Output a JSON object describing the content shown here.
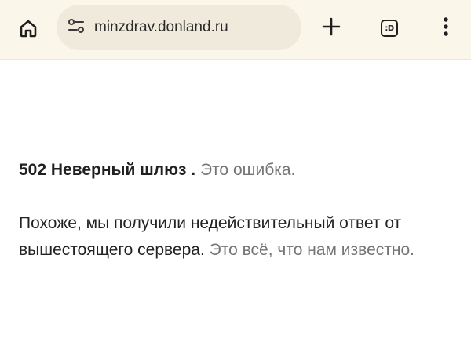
{
  "browser": {
    "url": "minzdrav.donland.ru",
    "tabs_count_label": ":D",
    "icons": {
      "home": "home-icon",
      "site_info": "tune-icon",
      "new_tab": "plus-icon",
      "tabs": "tab-switcher-icon",
      "menu": "more-vert-icon"
    }
  },
  "error": {
    "heading": "502 Неверный шлюз .",
    "heading_note": "Это ошибка.",
    "message": "Похоже, мы получили недействительный ответ от вышестоящего сервера.",
    "message_note": "Это всё, что нам известно."
  },
  "colors": {
    "toolbar_bg": "#fbf6ea",
    "omnibox_bg": "#f0eadc",
    "muted_text": "#757575"
  }
}
